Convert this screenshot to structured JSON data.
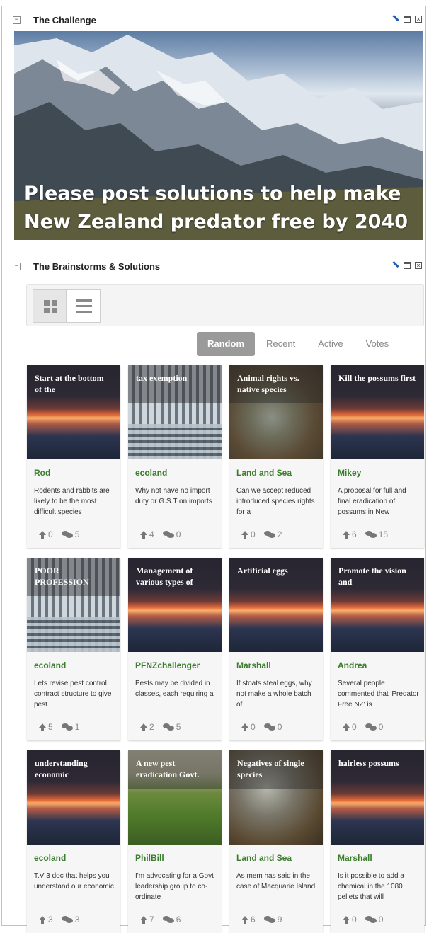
{
  "challenge_panel": {
    "title": "The Challenge",
    "collapse": "⊟",
    "hero_line1": "Please post solutions to help make",
    "hero_line2": "New Zealand predator free by 2040"
  },
  "solutions_panel": {
    "title": "The Brainstorms & Solutions",
    "collapse": "⊟"
  },
  "sort_tabs": [
    {
      "label": "Random",
      "active": true
    },
    {
      "label": "Recent",
      "active": false
    },
    {
      "label": "Active",
      "active": false
    },
    {
      "label": "Votes",
      "active": false
    }
  ],
  "cards": [
    {
      "title": "Start at the bottom of the",
      "author": "Rod",
      "excerpt": "Rodents and rabbits are likely to be the most difficult species",
      "votes": "0",
      "comments": "5",
      "image": "sunset"
    },
    {
      "title": "tax exemption",
      "author": "ecoland",
      "excerpt": "Why not have no import duty or G.S.T on imports",
      "votes": "4",
      "comments": "0",
      "image": "engine"
    },
    {
      "title": "Animal rights vs. native species",
      "author": "Land and Sea",
      "excerpt": "Can we accept reduced introduced species rights for a",
      "votes": "0",
      "comments": "2",
      "image": "rat"
    },
    {
      "title": "Kill the possums first",
      "author": "Mikey",
      "excerpt": "A proposal for full and final eradication of possums in New",
      "votes": "6",
      "comments": "15",
      "image": "sunset"
    },
    {
      "title": "POOR PROFESSION",
      "author": "ecoland",
      "excerpt": "Lets revise pest control contract structure to give pest",
      "votes": "5",
      "comments": "1",
      "image": "engine"
    },
    {
      "title": "Management of various types of",
      "author": "PFNZchallenger",
      "excerpt": "Pests may be divided in classes, each requiring a",
      "votes": "2",
      "comments": "5",
      "image": "sunset"
    },
    {
      "title": "Artificial eggs",
      "author": "Marshall",
      "excerpt": "If stoats steal eggs, why not make a whole batch of",
      "votes": "0",
      "comments": "0",
      "image": "sunset"
    },
    {
      "title": "Promote the vision and",
      "author": "Andrea",
      "excerpt": "Several people commented that 'Predator Free NZ' is",
      "votes": "0",
      "comments": "0",
      "image": "sunset"
    },
    {
      "title": "understanding economic",
      "author": "ecoland",
      "excerpt": "T.V 3 doc that helps you understand our economic",
      "votes": "3",
      "comments": "3",
      "image": "sunset"
    },
    {
      "title": "A new pest eradication Govt.",
      "author": "PhilBill",
      "excerpt": "I'm advocating for a Govt leadership group to co-ordinate",
      "votes": "7",
      "comments": "6",
      "image": "field"
    },
    {
      "title": "Negatives of single species",
      "author": "Land and Sea",
      "excerpt": "As mem has said in the case of Macquarie Island,",
      "votes": "6",
      "comments": "9",
      "image": "hedge"
    },
    {
      "title": "hairless possums",
      "author": "Marshall",
      "excerpt": "Is it possible to add a chemical in the 1080 pellets that will",
      "votes": "0",
      "comments": "0",
      "image": "sunset"
    }
  ]
}
